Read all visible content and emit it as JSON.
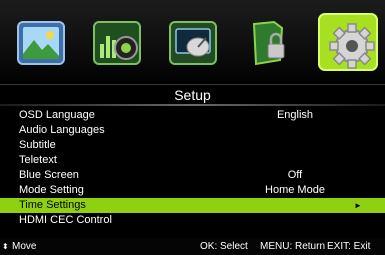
{
  "top_icons": [
    {
      "name": "picture-icon",
      "active": false
    },
    {
      "name": "sound-icon",
      "active": false
    },
    {
      "name": "channel-icon",
      "active": false
    },
    {
      "name": "lock-icon",
      "active": false
    },
    {
      "name": "setup-gear-icon",
      "active": true
    }
  ],
  "menu": {
    "title": "Setup",
    "items": [
      {
        "label": "OSD Language",
        "value": "English"
      },
      {
        "label": "Audio Languages",
        "value": ""
      },
      {
        "label": "Subtitle",
        "value": ""
      },
      {
        "label": "Teletext",
        "value": ""
      },
      {
        "label": "Blue Screen",
        "value": "Off"
      },
      {
        "label": "Mode Setting",
        "value": "Home Mode"
      },
      {
        "label": "Time Settings",
        "value": "",
        "selected": true,
        "arrow": "►"
      },
      {
        "label": "HDMI CEC Control",
        "value": ""
      }
    ]
  },
  "footer": {
    "move_icon": "⬍",
    "move": "Move",
    "ok": "OK: Select",
    "menu": "MENU: Return",
    "exit": "EXIT: Exit"
  },
  "colors": {
    "highlight": "#8fd111",
    "background": "#000000"
  }
}
